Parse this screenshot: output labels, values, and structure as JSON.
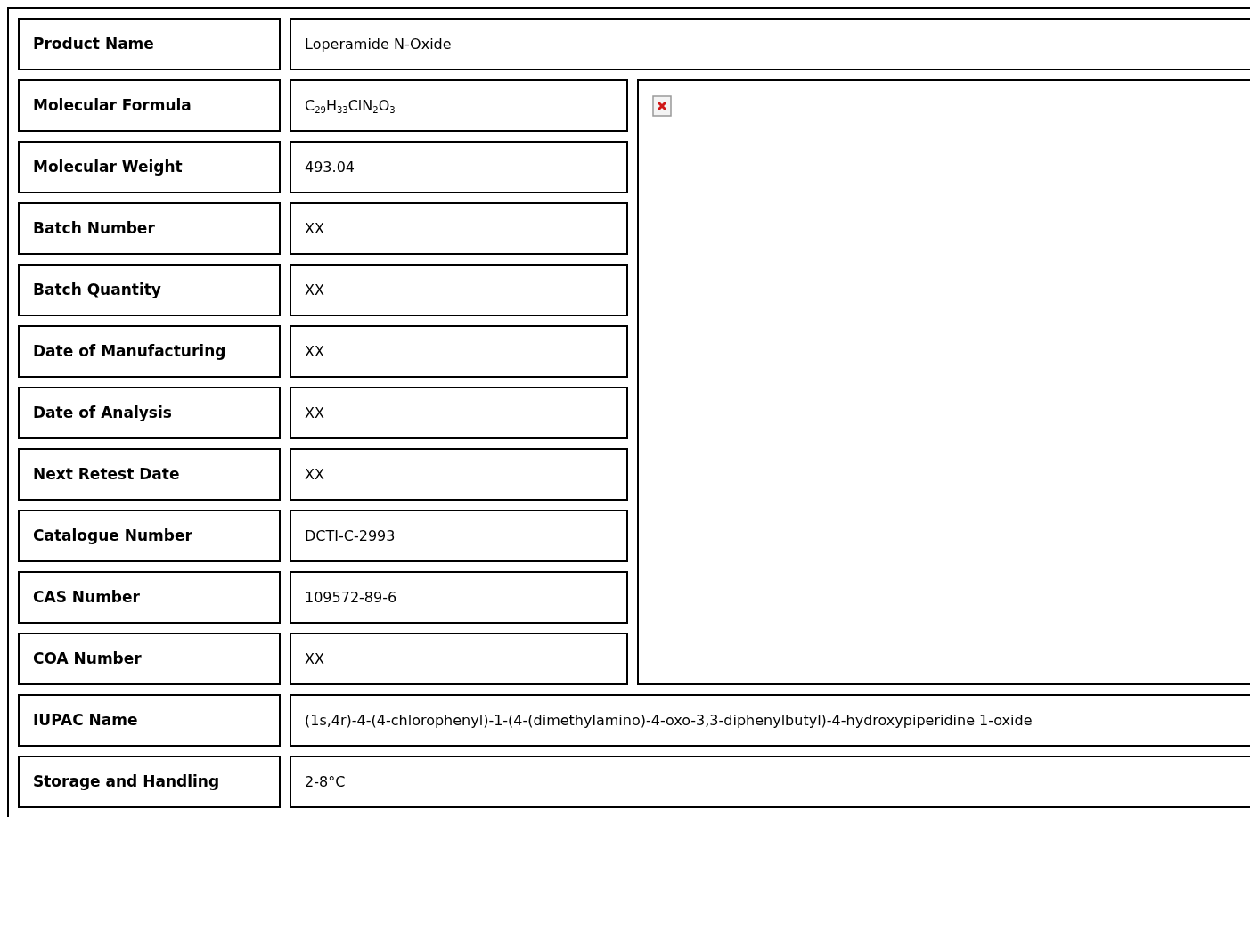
{
  "top_rows": [
    {
      "label": "Product Name",
      "value": "Loperamide N-Oxide"
    }
  ],
  "detail_rows": [
    {
      "label": "Molecular Formula",
      "value": "C$_{29}$H$_{33}$ClN$_{2}$O$_{3}$"
    },
    {
      "label": "Molecular Weight",
      "value": "493.04"
    },
    {
      "label": "Batch Number",
      "value": "XX"
    },
    {
      "label": "Batch Quantity",
      "value": "XX"
    },
    {
      "label": "Date of Manufacturing",
      "value": "XX"
    },
    {
      "label": "Date of Analysis",
      "value": "XX"
    },
    {
      "label": "Next Retest Date",
      "value": "XX"
    },
    {
      "label": "Catalogue Number",
      "value": "DCTI-C-2993"
    },
    {
      "label": "CAS Number",
      "value": "109572-89-6"
    },
    {
      "label": "COA Number",
      "value": "XX"
    }
  ],
  "bottom_rows": [
    {
      "label": "IUPAC Name",
      "value": "(1s,4r)-4-(4-chlorophenyl)-1-(4-(dimethylamino)-4-oxo-3,3-diphenylbutyl)-4-hydroxypiperidine 1-oxide"
    },
    {
      "label": "Storage and Handling",
      "value": "2-8°C"
    }
  ]
}
